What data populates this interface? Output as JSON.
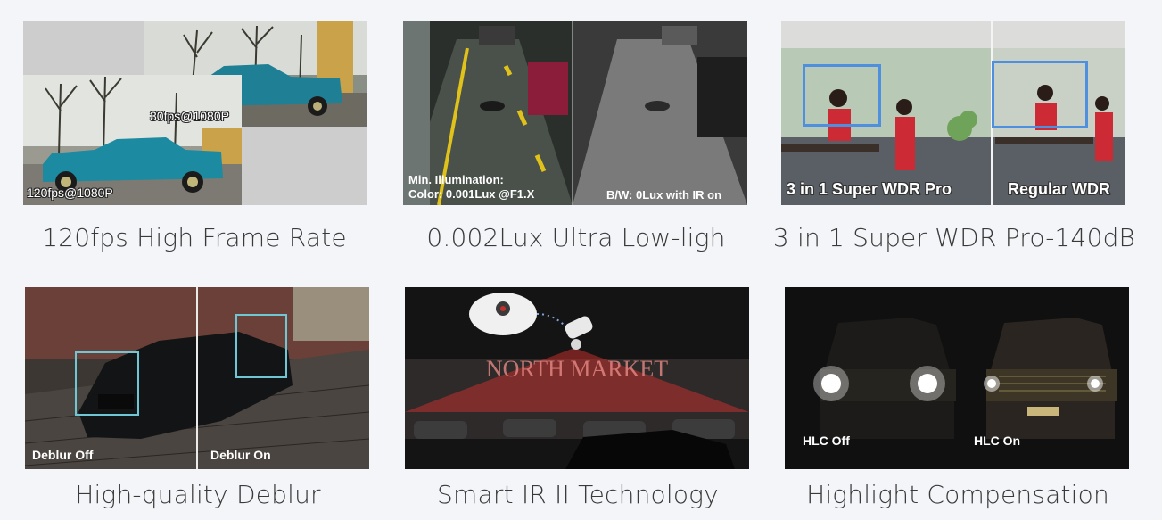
{
  "features": [
    {
      "caption": "120fps High Frame Rate",
      "overlays": {
        "top_label": "30fps@1080P",
        "bottom_label": "120fps@1080P"
      },
      "icon": "frame-rate-image"
    },
    {
      "caption": "0.002Lux Ultra Low-ligh",
      "overlays": {
        "left_line1": "Min. Illumination:",
        "left_line2": "Color: 0.001Lux @F1.X",
        "right": "B/W: 0Lux with IR on"
      },
      "icon": "low-light-image"
    },
    {
      "caption": "3 in 1 Super WDR Pro-140dB",
      "overlays": {
        "left": "3 in 1 Super WDR Pro",
        "right": "Regular WDR"
      },
      "icon": "wdr-image"
    },
    {
      "caption": "High-quality Deblur",
      "overlays": {
        "left": "Deblur Off",
        "right": "Deblur On"
      },
      "icon": "deblur-image"
    },
    {
      "caption": "Smart IR II Technology",
      "overlays": {
        "sign": "NORTH MARKET"
      },
      "icon": "smart-ir-image"
    },
    {
      "caption": "Highlight Compensation",
      "overlays": {
        "left": "HLC Off",
        "right": "HLC On"
      },
      "icon": "hlc-image"
    }
  ],
  "colors": {
    "background": "#f3f5f8",
    "caption_text": "#3a3a3a",
    "ir_red": "#c0302c",
    "wdr_box": "#4f8fe0",
    "deblur_box": "#6fc7d6"
  }
}
